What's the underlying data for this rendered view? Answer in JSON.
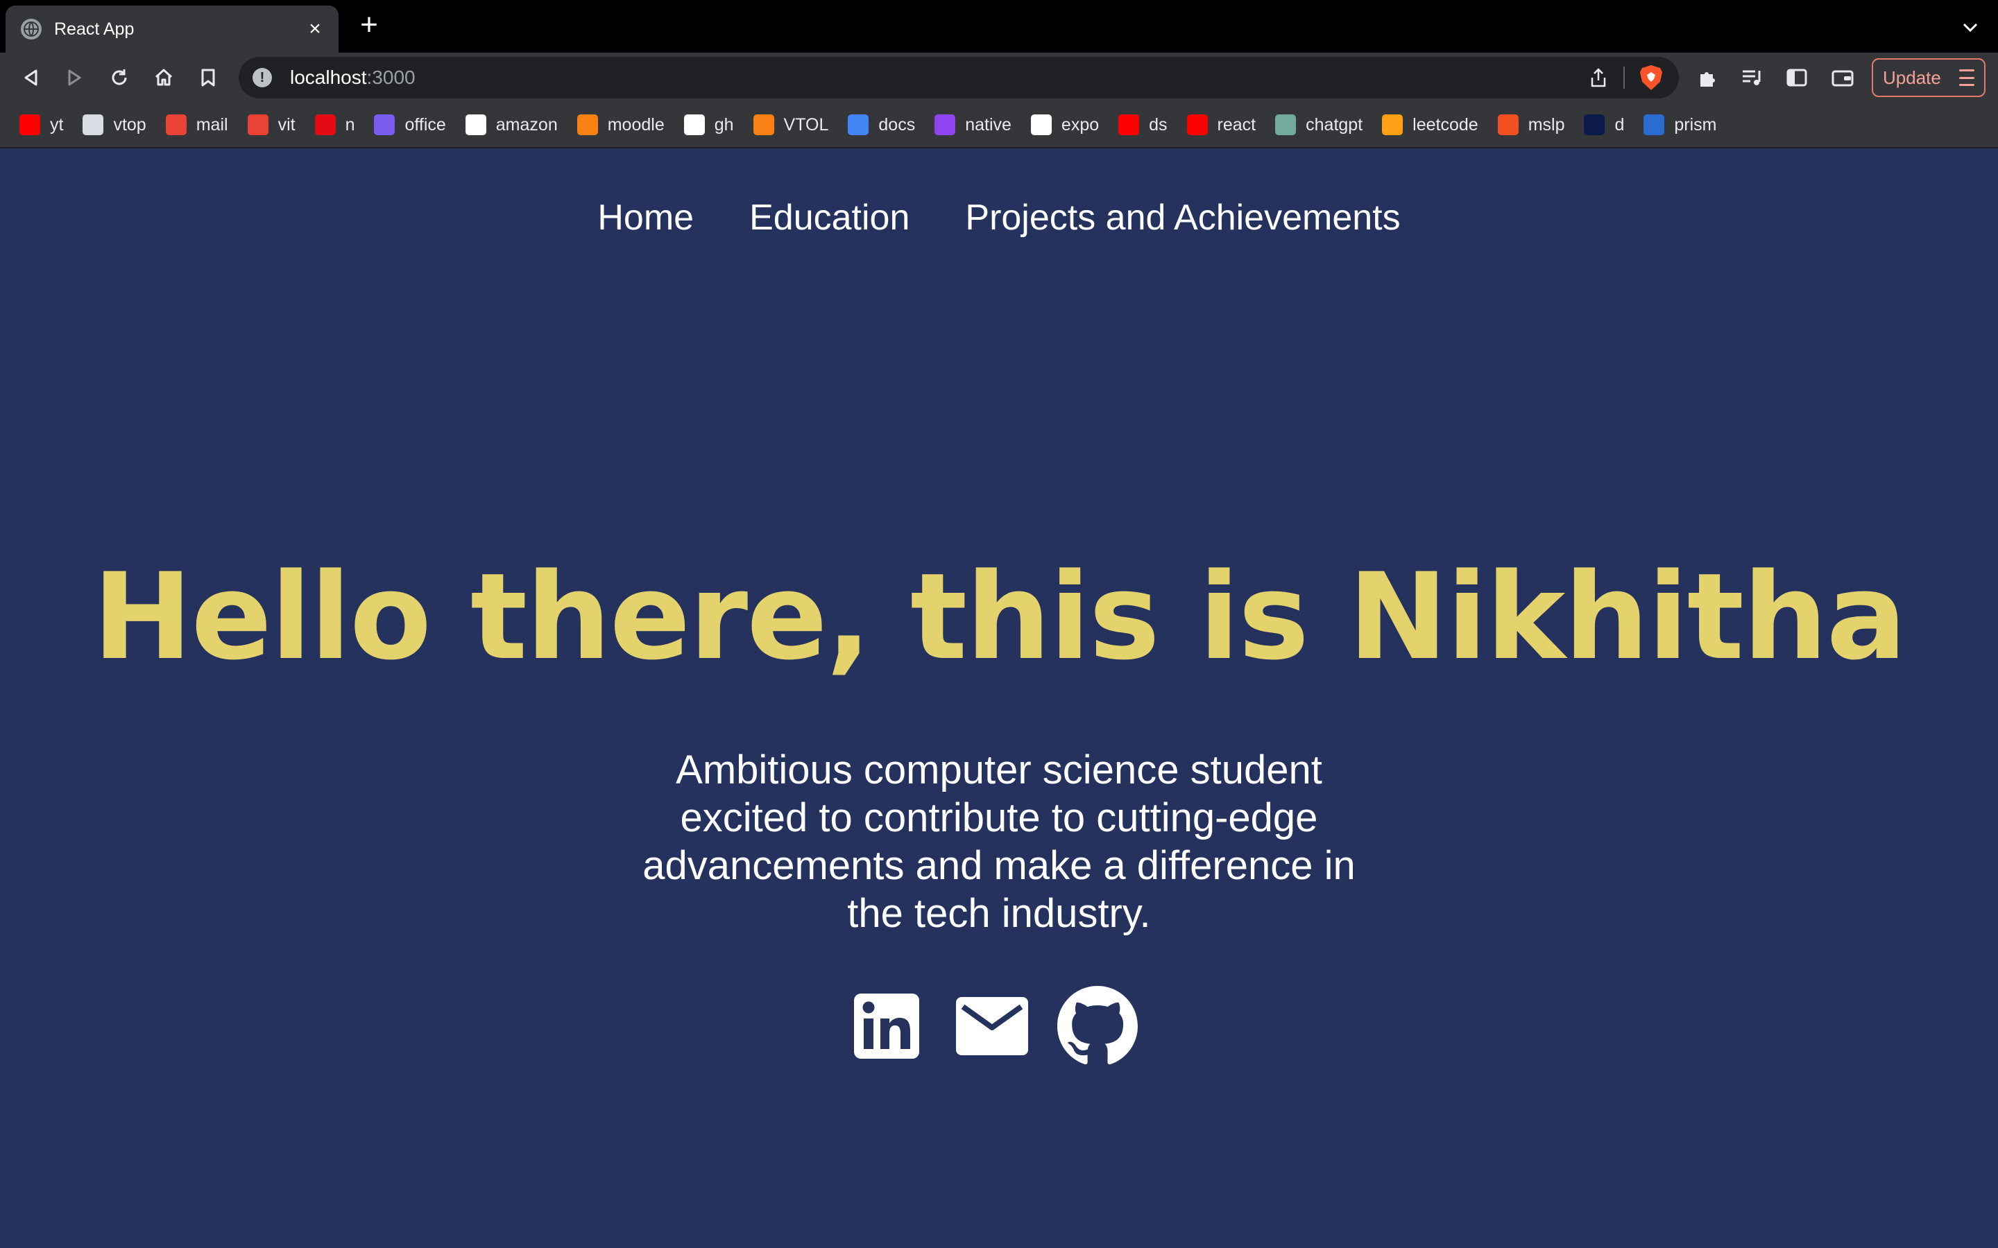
{
  "browser": {
    "tab": {
      "title": "React App",
      "close_glyph": "×"
    },
    "new_tab_glyph": "+",
    "address": {
      "host": "localhost",
      "port": ":3000"
    },
    "update_label": "Update",
    "bookmarks": [
      {
        "label": "yt",
        "icon": "youtube-icon",
        "color": "#ff0000"
      },
      {
        "label": "vtop",
        "icon": "vtop-icon",
        "color": "#d9dce3"
      },
      {
        "label": "mail",
        "icon": "gmail-icon",
        "color": "#ea4335"
      },
      {
        "label": "vit",
        "icon": "gmail-icon",
        "color": "#ea4335"
      },
      {
        "label": "n",
        "icon": "netflix-icon",
        "color": "#e50914"
      },
      {
        "label": "office",
        "icon": "office-icon",
        "color": "#7b5cf0"
      },
      {
        "label": "amazon",
        "icon": "amazon-icon",
        "color": "#ffffff"
      },
      {
        "label": "moodle",
        "icon": "moodle-icon",
        "color": "#f98012"
      },
      {
        "label": "gh",
        "icon": "github-icon",
        "color": "#ffffff"
      },
      {
        "label": "VTOL",
        "icon": "moodle-icon",
        "color": "#f98012"
      },
      {
        "label": "docs",
        "icon": "docs-icon",
        "color": "#4285f4"
      },
      {
        "label": "native",
        "icon": "native-icon",
        "color": "#8e44ef"
      },
      {
        "label": "expo",
        "icon": "expo-icon",
        "color": "#ffffff"
      },
      {
        "label": "ds",
        "icon": "youtube-icon",
        "color": "#ff0000"
      },
      {
        "label": "react",
        "icon": "youtube-icon",
        "color": "#ff0000"
      },
      {
        "label": "chatgpt",
        "icon": "chatgpt-icon",
        "color": "#74aa9c"
      },
      {
        "label": "leetcode",
        "icon": "leetcode-icon",
        "color": "#ffa116"
      },
      {
        "label": "mslp",
        "icon": "microsoft-icon",
        "color": "#f25022"
      },
      {
        "label": "d",
        "icon": "dh-icon",
        "color": "#0b1a4a"
      },
      {
        "label": "prism",
        "icon": "prism-icon",
        "color": "#2b6cd1"
      }
    ]
  },
  "nav": {
    "home": "Home",
    "education": "Education",
    "projects": "Projects and Achievements"
  },
  "hero": {
    "title": "Hello there, this is Nikhitha",
    "subtitle": "Ambitious computer science student excited to contribute to cutting-edge advancements and make a difference in the tech industry."
  },
  "socials": [
    {
      "name": "linkedin-icon"
    },
    {
      "name": "mail-icon"
    },
    {
      "name": "github-icon"
    }
  ],
  "colors": {
    "page_bg": "#25325d",
    "title_yellow": "#e4d26d",
    "text_white": "#ffffff"
  }
}
